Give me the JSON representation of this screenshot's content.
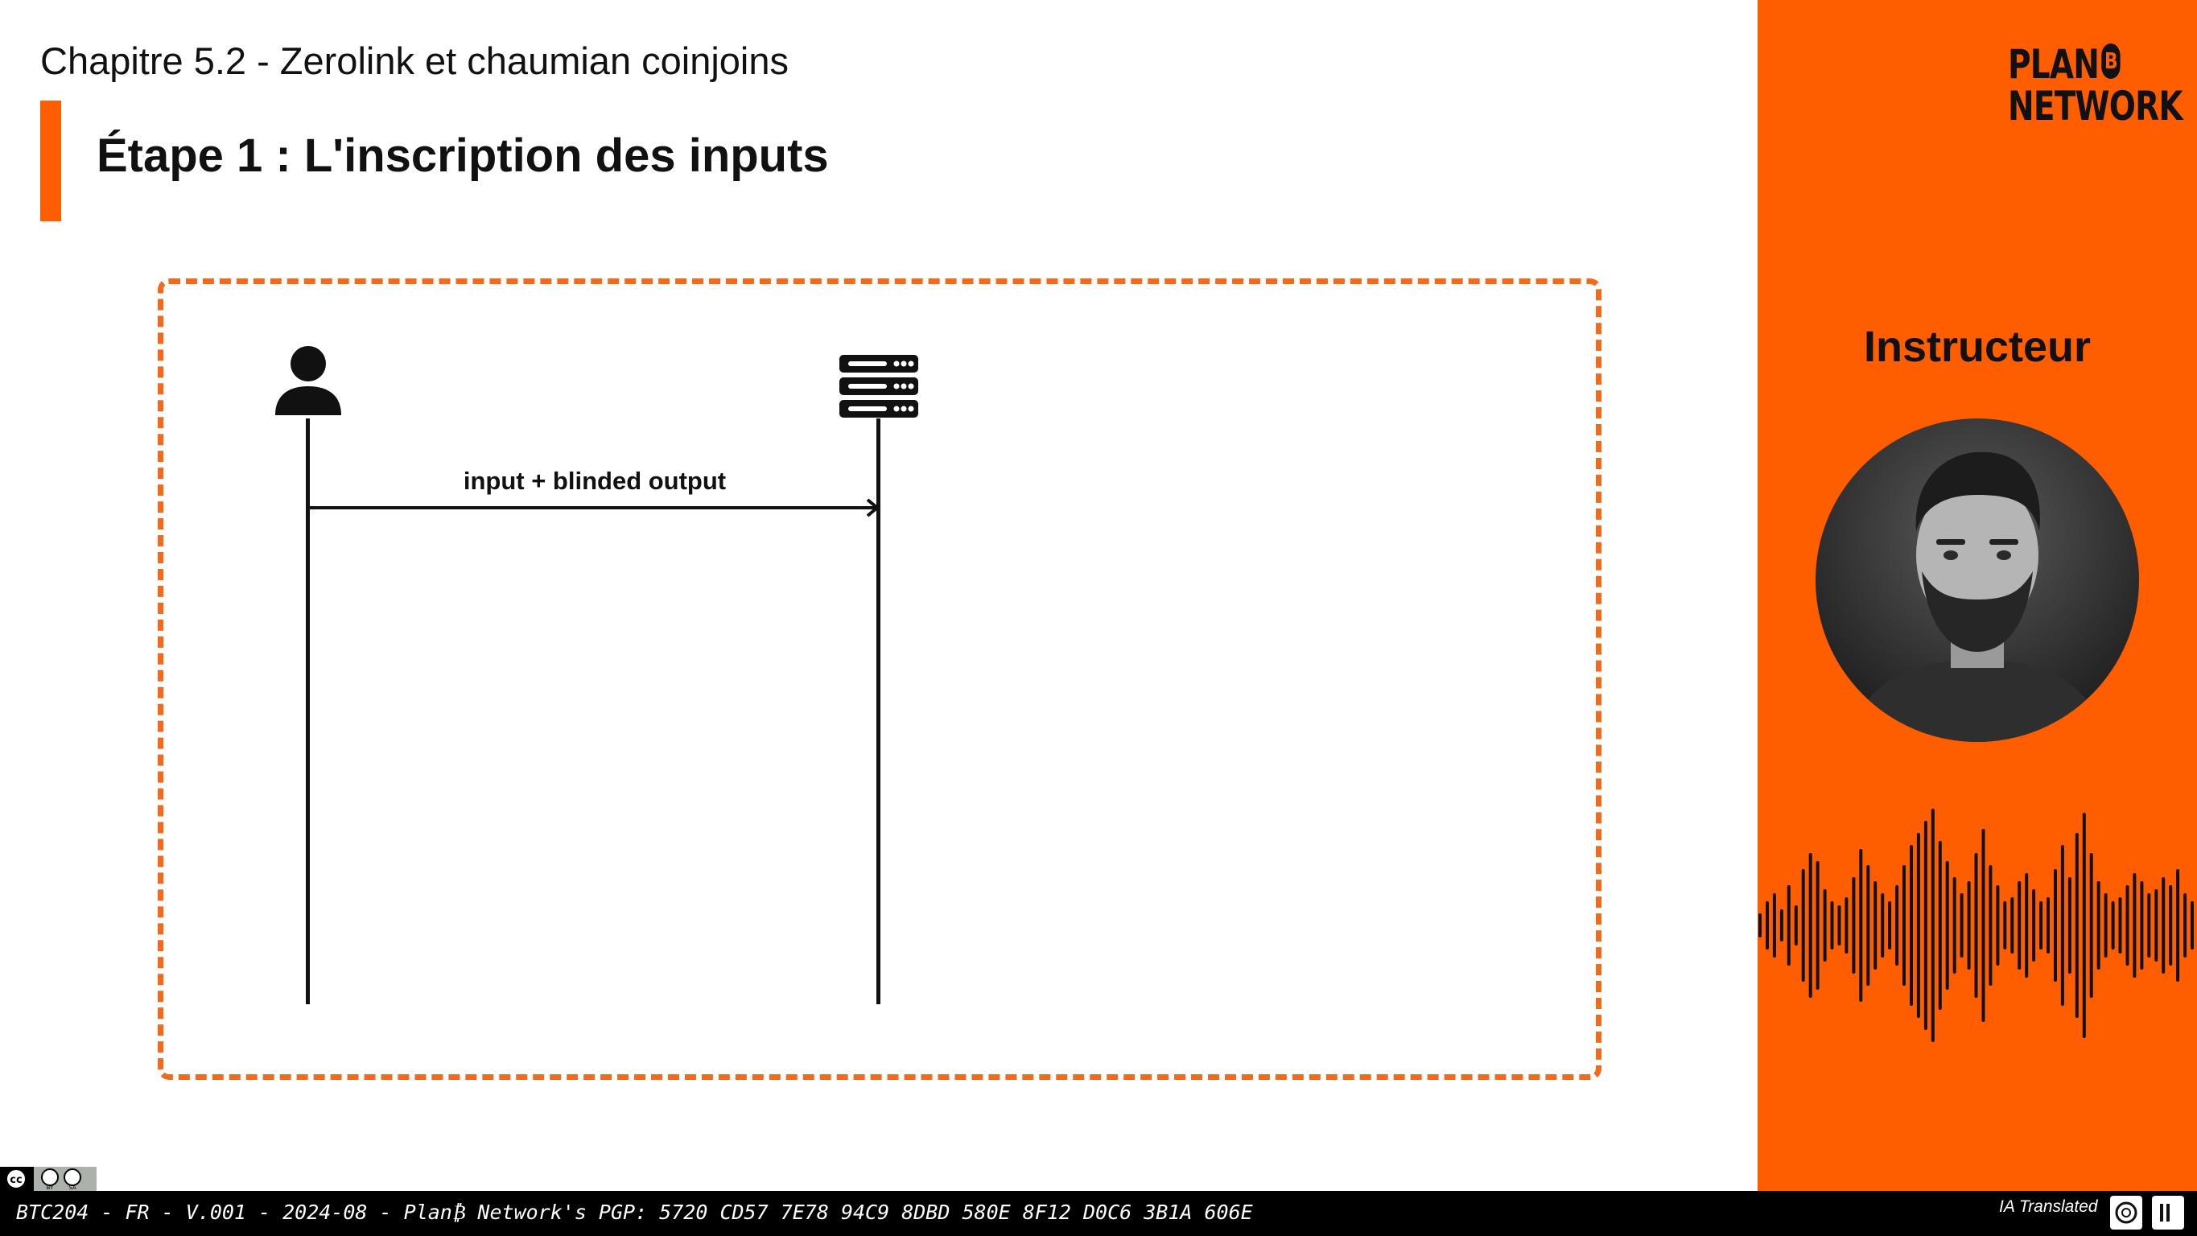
{
  "slide": {
    "chapter": "Chapitre 5.2 - Zerolink et chaumian coinjoins",
    "title": "Étape 1 : L'inscription des inputs"
  },
  "diagram": {
    "actors": [
      {
        "icon": "user-icon"
      },
      {
        "icon": "server-icon"
      }
    ],
    "messages": [
      {
        "from": 0,
        "to": 1,
        "label": "input + blinded output"
      }
    ]
  },
  "sidebar": {
    "logo_line1": "PLAN",
    "logo_badge": "B",
    "logo_line2": "NETWORK",
    "instructor_label": "Instructeur",
    "accent_color": "#ff5e00"
  },
  "footer": {
    "text": "BTC204 - FR - V.001 - 2024-08 - Plan₿ Network's PGP: 5720 CD57 7E78 94C9 8DBD 580E 8F12 D0C6 3B1A 606E",
    "ia_label": "IA Translated",
    "license": "cc BY SA"
  }
}
